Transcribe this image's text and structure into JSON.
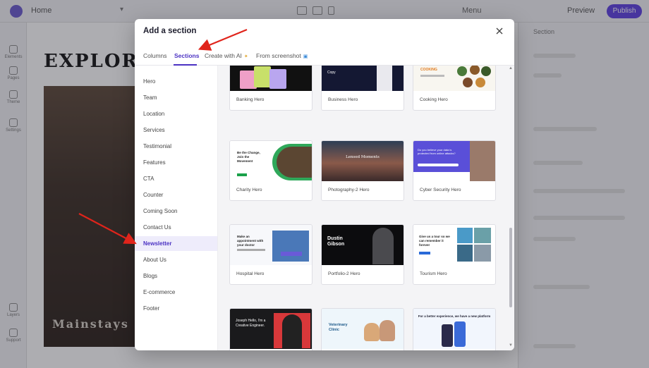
{
  "modal": {
    "title": "Add a section",
    "tabs": [
      {
        "label": "Columns"
      },
      {
        "label": "Sections"
      },
      {
        "label": "Create with AI",
        "badge": "✦"
      },
      {
        "label": "From screenshot",
        "badge": "▣"
      }
    ],
    "active_tab": "Sections",
    "categories": [
      "Hero",
      "Team",
      "Location",
      "Services",
      "Testimonial",
      "Features",
      "CTA",
      "Counter",
      "Coming Soon",
      "Contact Us",
      "Newsletter",
      "About Us",
      "Blogs",
      "E-commerce",
      "Footer"
    ],
    "active_category": "Newsletter",
    "templates": [
      {
        "label": "Banking Hero",
        "heading": ""
      },
      {
        "label": "Business Hero",
        "heading": "Copy"
      },
      {
        "label": "Cooking Hero",
        "heading": "COOKING"
      },
      {
        "label": "Charity Hero",
        "heading": "Be the Change, Join the Movement"
      },
      {
        "label": "Photography-2 Hero",
        "heading": "Lensed Moments"
      },
      {
        "label": "Cyber Security Hero",
        "heading": "Do you believe your data is protected from online attacks?"
      },
      {
        "label": "Hospital Hero",
        "heading": "Make an appointment with your doctor"
      },
      {
        "label": "Portfolio-2 Hero",
        "heading": "Dustin Gibson"
      },
      {
        "label": "Tourism Hero",
        "heading": "Give us a tour so we can remember it forever"
      },
      {
        "label": "",
        "heading": "Joseph Hello, I'm a Creative Engineer."
      },
      {
        "label": "",
        "heading": "Veterinary Clinic"
      },
      {
        "label": "",
        "heading": "For a better experience, we have a new platform"
      }
    ]
  },
  "background": {
    "page_name": "Home",
    "menu_label": "Menu",
    "preview_label": "Preview",
    "publish_label": "Publish",
    "hero_title": "EXPLORE",
    "hero_caption": "Mainstays",
    "right_panel_title": "Section",
    "left_bar": [
      "Elements",
      "Pages",
      "Theme",
      "Settings",
      "Layers",
      "Support"
    ]
  },
  "colors": {
    "accent": "#4b32c3",
    "arrow": "#e0241b"
  }
}
